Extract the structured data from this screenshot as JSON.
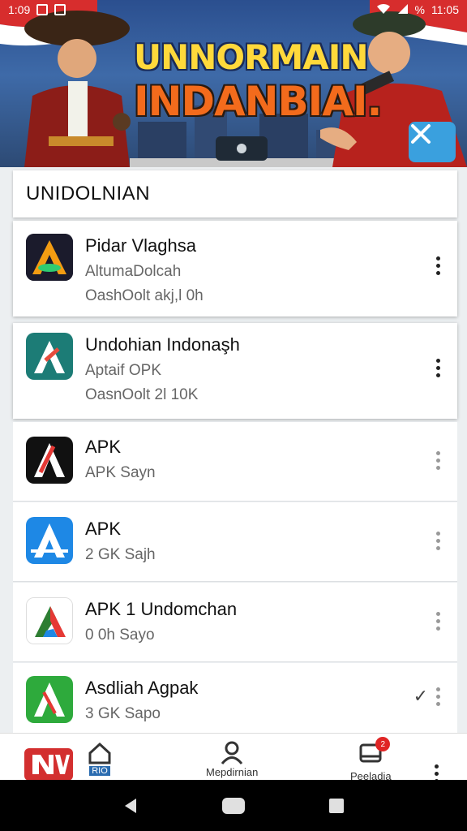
{
  "status_bar": {
    "left_time": "1:09",
    "right_time": "11:05",
    "signal_label": "%"
  },
  "banner": {
    "line1": "UNNORMAIN",
    "line2": "INDANBIAI."
  },
  "section": {
    "title": "UNIDOLNIAN"
  },
  "apps": [
    {
      "title": "Pidar Vlaghsa",
      "sub": "AltumaDolcah",
      "sub2": "OashOolt akj,l 0h"
    },
    {
      "title": "Undohian Indonaşh",
      "sub": "Aptaif OPK",
      "sub2": "OasnOolt 2l 10K"
    },
    {
      "title": "APK",
      "sub": "APK Sayn"
    },
    {
      "title": "APK",
      "sub": "2 GK Sajh"
    },
    {
      "title": "APK 1 Undomchan",
      "sub": "0 0h Sayo"
    },
    {
      "title": "Asdliah Agpak",
      "sub": "3 GK Sapo"
    }
  ],
  "bottom_nav": {
    "item1_badge": "RIO",
    "item2_label": "Mepdirnian",
    "item3_label": "Peeladia",
    "item3_badge": "2"
  },
  "colors": {
    "accent": "#3aa0de",
    "badge": "#e02525"
  }
}
